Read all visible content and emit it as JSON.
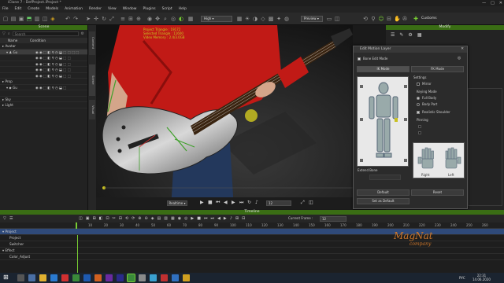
{
  "window": {
    "title": "iClone 7 - DefProject.iProject *",
    "controls": [
      "—",
      "□",
      "✕"
    ]
  },
  "menu": [
    "File",
    "Edit",
    "Create",
    "Models",
    "Animation",
    "Render",
    "View",
    "Window",
    "Plugins",
    "Script",
    "Help"
  ],
  "toolbar": {
    "quality": "High",
    "mode": "Preview",
    "customs_label": "Customs"
  },
  "scene": {
    "title": "Scene",
    "search_placeholder": "Search",
    "col_name": "Name",
    "col_condition": "Condition",
    "items": [
      {
        "label": "Avatar"
      },
      {
        "label": "Gu"
      },
      {
        "label": ""
      },
      {
        "label": ""
      },
      {
        "label": ""
      },
      {
        "label": ""
      },
      {
        "label": "Prop"
      },
      {
        "label": "Gu"
      },
      {
        "label": ""
      },
      {
        "label": "Sky"
      },
      {
        "label": "Light"
      }
    ]
  },
  "side_tabs": [
    "Content",
    "Scene",
    "Visual"
  ],
  "viewport": {
    "stats": [
      "Project Triangle : 19172",
      "Selected Triangle : 11600",
      "Video Memory : 2.4/3.0GB"
    ]
  },
  "playbar": {
    "realtime": "Realtime",
    "frame": "12"
  },
  "modify": {
    "title": "Modify"
  },
  "edit_motion": {
    "title": "Edit Motion Layer",
    "bone_edit_mode": "Bone Edit Mode",
    "ik_mode": "IK Mode",
    "fk_mode": "FK Mode",
    "settings": "Settings",
    "mirror": "Mirror",
    "keying_mode": "Keying Mode",
    "full_body": "Full Body",
    "body_part": "Body Part",
    "realistic_shoulder": "Realistic Shoulder",
    "pinning": "Pinning",
    "extend_bone": "Extend Bone",
    "right": "Right",
    "left": "Left",
    "default_btn": "Default",
    "reset_btn": "Reset",
    "set_default_btn": "Set as Default"
  },
  "timeline": {
    "title": "Timeline",
    "current_frame_label": "Current Frame :",
    "current_frame": "12",
    "ruler": [
      "10",
      "20",
      "30",
      "40",
      "50",
      "60",
      "70",
      "80",
      "90",
      "100",
      "110",
      "120",
      "130",
      "140",
      "150",
      "160",
      "170",
      "180",
      "190",
      "200",
      "210",
      "220",
      "230",
      "240",
      "250",
      "260"
    ],
    "tracks": [
      {
        "label": "Project"
      },
      {
        "label": "Project"
      },
      {
        "label": "Switcher"
      },
      {
        "label": "Effect"
      },
      {
        "label": "Color_Adjust"
      }
    ]
  },
  "watermark": {
    "line1": "MagNat",
    "line2": "company"
  },
  "taskbar": {
    "clock": "22:31",
    "date": "14.06.2020",
    "lang": "РУС"
  },
  "colors": {
    "accent": "#3a6d14",
    "guitar": "#c8c8c8",
    "shirt": "#c11a16"
  }
}
